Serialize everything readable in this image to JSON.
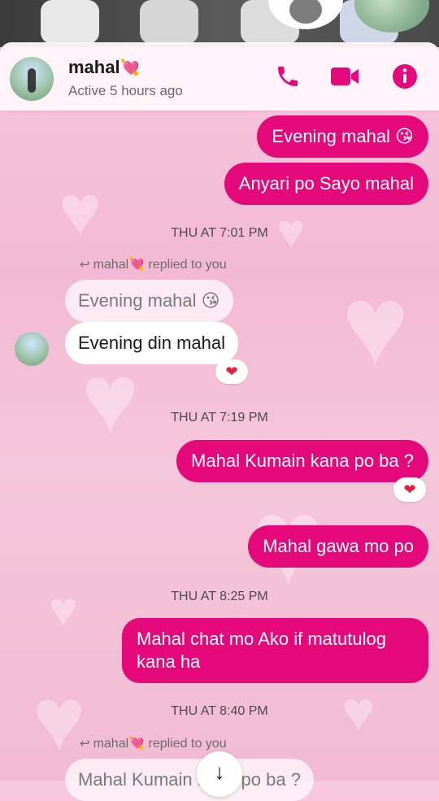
{
  "header": {
    "name": "mahal",
    "name_emoji": "💘",
    "status": "Active 5 hours ago"
  },
  "messages": {
    "out1": "Evening mahal 😘",
    "out2": "Anyari po Sayo mahal",
    "time1": "THU AT 7:01 PM",
    "replied1": "mahal💘 replied to you",
    "in_quoted": "Evening mahal 😘",
    "in1": "Evening din mahal",
    "react1": "❤",
    "time2": "THU AT 7:19 PM",
    "out3": "Mahal Kumain kana po ba ?",
    "react2": "❤",
    "out4": "Mahal gawa mo po",
    "time3": "THU AT 8:25 PM",
    "out5_line1": "Mahal chat mo Ako if matutulog",
    "out5_line2": "kana ha",
    "time4": "THU AT 8:40 PM",
    "replied2": "mahal💘 replied to you",
    "in_quoted2": "Mahal Kumain kana po ba ?"
  },
  "icons": {
    "phone": "phone-icon",
    "video": "video-call-icon",
    "info": "info-icon",
    "reply": "reply-arrow-icon",
    "scroll": "arrow-down-icon"
  },
  "colors": {
    "accent": "#e5087a",
    "background": "#f5c5da"
  }
}
